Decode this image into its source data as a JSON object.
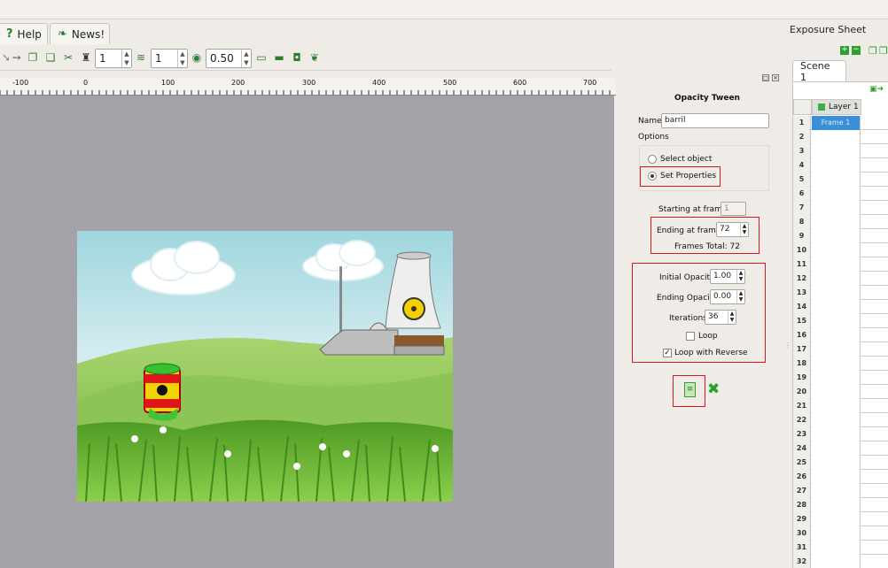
{
  "tabs": [
    {
      "label": "Help",
      "icon": "help-icon"
    },
    {
      "label": "News!",
      "icon": "news-icon"
    }
  ],
  "toolbar": {
    "spin1": "1",
    "spin2": "1",
    "opacity": "0.50"
  },
  "ruler": {
    "ticks": [
      "-100",
      "0",
      "100",
      "200",
      "300",
      "400",
      "500",
      "600",
      "700"
    ]
  },
  "tween": {
    "title": "Opacity Tween",
    "name_label": "Name:",
    "name_value": "barril",
    "options_label": "Options",
    "radio_select": "Select object",
    "radio_set": "Set Properties",
    "start_label": "Starting at frame:",
    "start_value": "1",
    "end_label": "Ending at frame:",
    "end_value": "72",
    "frames_total": "Frames Total: 72",
    "initial_label": "Initial Opacity:",
    "initial_value": "1.00",
    "ending_label": "Ending Opacity:",
    "ending_value": "0.00",
    "iter_label": "Iterations:",
    "iter_value": "36",
    "loop_label": "Loop",
    "loop_reverse_label": "Loop with Reverse"
  },
  "exposure": {
    "title": "Exposure Sheet",
    "scene_tab": "Scene 1",
    "layer_label": "Layer 1",
    "frame1": "Frame 1",
    "rows": [
      "1",
      "2",
      "3",
      "4",
      "5",
      "6",
      "7",
      "8",
      "9",
      "10",
      "11",
      "12",
      "13",
      "14",
      "15",
      "16",
      "17",
      "18",
      "19",
      "20",
      "21",
      "22",
      "23",
      "24",
      "25",
      "26",
      "27",
      "28",
      "29",
      "30",
      "31",
      "32"
    ]
  },
  "colors": {
    "accent_red": "#e0141b",
    "frame_selected": "#3a8fd8",
    "layer_green": "#3cb043"
  }
}
